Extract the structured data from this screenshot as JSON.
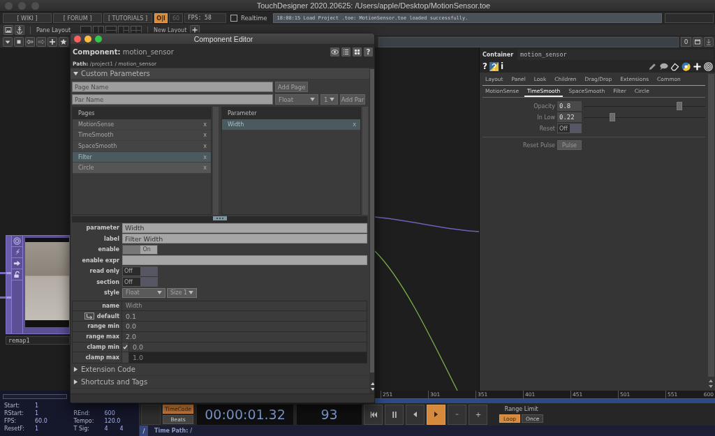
{
  "window": {
    "title": "TouchDesigner 2020.20625: /Users/apple/Desktop/MotionSensor.toe"
  },
  "toolbar": {
    "links": [
      "[ WIKI ]",
      "[ FORUM ]",
      "[ TUTORIALS ]"
    ],
    "perform_toggle": {
      "label": "O|I",
      "on": true
    },
    "fps_limit": "60",
    "fps": "FPS: 58",
    "realtime": {
      "label": "Realtime",
      "checked": false
    },
    "status": "18:08:15 Load Project .toe: MotionSensor.toe loaded successfully."
  },
  "layout_bar": {
    "pane_layout": "Pane Layout",
    "new_layout": "New Layout"
  },
  "nav_bar": {
    "counter": "0"
  },
  "network": {
    "node": {
      "name": "remap1"
    }
  },
  "parameter_panel": {
    "type": "Container",
    "name": "motion_sensor",
    "help": "?",
    "info": "i",
    "tab_rows": [
      {
        "tabs": [
          {
            "label": "Layout",
            "selected": false
          },
          {
            "label": "Panel",
            "selected": false
          },
          {
            "label": "Look",
            "selected": false
          },
          {
            "label": "Children",
            "selected": false
          },
          {
            "label": "Drag/Drop",
            "selected": false
          },
          {
            "label": "Extensions",
            "selected": false
          },
          {
            "label": "Common",
            "selected": false
          }
        ]
      },
      {
        "tabs": [
          {
            "label": "MotionSense",
            "selected": false
          },
          {
            "label": "TimeSmooth",
            "selected": true
          },
          {
            "label": "SpaceSmooth",
            "selected": false
          },
          {
            "label": "Filter",
            "selected": false
          },
          {
            "label": "Circle",
            "selected": false
          }
        ]
      }
    ],
    "parameter_groups": [
      {
        "parameters": [
          {
            "kind": "slider",
            "label": "Opacity",
            "value": "0.8",
            "level": 0.8
          },
          {
            "kind": "slider",
            "label": "In Low",
            "value": "0.22",
            "level": 0.22
          },
          {
            "kind": "toggle",
            "label": "Reset",
            "value": "Off",
            "on": false
          }
        ]
      },
      {
        "parameters": [
          {
            "kind": "pulse",
            "label": "Reset Pulse",
            "button": "Pulse"
          }
        ]
      }
    ]
  },
  "component_editor": {
    "title": "Component Editor",
    "component": "**Component:** motion_sensor",
    "path": "**Path:** /project1 / motion_sensor",
    "help": "?",
    "custom_parameters": {
      "title": "Custom Parameters",
      "expanded": true,
      "page_name": {
        "placeholder": "Page Name"
      },
      "add_page": "Add Page",
      "par_name": {
        "placeholder": "Par Name"
      },
      "par_type": "Float",
      "par_size": "1",
      "add_par": "Add Par",
      "pages_header": "Pages",
      "pages": [
        {
          "name": "MotionSense",
          "remove": "x",
          "selected": false,
          "hovered": false
        },
        {
          "name": "TimeSmooth",
          "remove": "x",
          "selected": false,
          "hovered": false
        },
        {
          "name": "SpaceSmooth",
          "remove": "x",
          "selected": false,
          "hovered": false
        },
        {
          "name": "Filter",
          "remove": "x",
          "selected": true,
          "hovered": false
        },
        {
          "name": "Circle",
          "remove": "x",
          "selected": false,
          "hovered": true
        }
      ],
      "parameters_header": "Parameter",
      "parameters": [
        {
          "name": "Width",
          "remove": "x",
          "selected": true
        }
      ],
      "properties": [
        {
          "kind": "text",
          "label": "parameter",
          "value": "Width"
        },
        {
          "kind": "text",
          "label": "label",
          "value": "Filter Width"
        },
        {
          "kind": "toggle",
          "label": "enable",
          "value": "On",
          "on": true
        },
        {
          "kind": "text",
          "label": "enable expr"
        },
        {
          "kind": "toggle",
          "label": "read only",
          "value": "Off",
          "on": false
        },
        {
          "kind": "toggle",
          "label": "section",
          "value": "Off",
          "on": false
        },
        {
          "kind": "menus",
          "label": "style",
          "menus": [
            "Float",
            "Size 1"
          ]
        }
      ],
      "values": [
        {
          "kind": "name",
          "label": "name",
          "value": "Width"
        },
        {
          "kind": "default",
          "label": "default",
          "value": "0.1"
        },
        {
          "kind": "plain",
          "label": "range min",
          "value": "0.0"
        },
        {
          "kind": "plain",
          "label": "range max",
          "value": "2.0"
        },
        {
          "kind": "clamp",
          "label": "clamp min",
          "value": "0.0",
          "checked": true
        },
        {
          "kind": "clamp",
          "label": "clamp max",
          "value": "1.0",
          "checked": false
        }
      ]
    },
    "sections": [
      {
        "title": "Extension Code",
        "expanded": false
      },
      {
        "title": "Shortcuts and Tags",
        "expanded": false
      }
    ]
  },
  "timeline": {
    "ticks": [
      "251",
      "301",
      "351",
      "401",
      "451",
      "501",
      "551",
      "600"
    ]
  },
  "time_settings": {
    "columns": [
      {
        "entries": [
          {
            "label": "Start:",
            "values": [
              "1"
            ]
          },
          {
            "label": "RStart:",
            "values": [
              "1"
            ]
          },
          {
            "label": "FPS:",
            "values": [
              "60.0"
            ]
          },
          {
            "label": "ResetF:",
            "values": [
              "1"
            ]
          }
        ]
      },
      {
        "entries": [
          {
            "label": "REnd:",
            "values": [
              "600"
            ]
          },
          {
            "label": "Tempo:",
            "values": [
              "120.0"
            ]
          },
          {
            "label": "T Sig:",
            "values": [
              "4",
              "4"
            ]
          }
        ]
      }
    ]
  },
  "transport": {
    "time_modes": [
      {
        "label": "TimeCode",
        "selected": true
      },
      {
        "label": "Beats",
        "selected": false
      }
    ],
    "timecode": "00:00:01.32",
    "frame": "93",
    "controls": [
      {
        "kind": "rewind",
        "active": false
      },
      {
        "kind": "pause",
        "active": false
      },
      {
        "kind": "step_back",
        "active": false
      },
      {
        "kind": "play",
        "active": true
      },
      {
        "kind": "minus",
        "active": false
      },
      {
        "kind": "plus",
        "active": false
      }
    ],
    "range_limit": {
      "label": "Range Limit",
      "options": [
        {
          "label": "Loop",
          "selected": true
        },
        {
          "label": "Once",
          "selected": false
        }
      ]
    }
  },
  "time_path": {
    "root": "/",
    "label": "Time Path: /"
  }
}
